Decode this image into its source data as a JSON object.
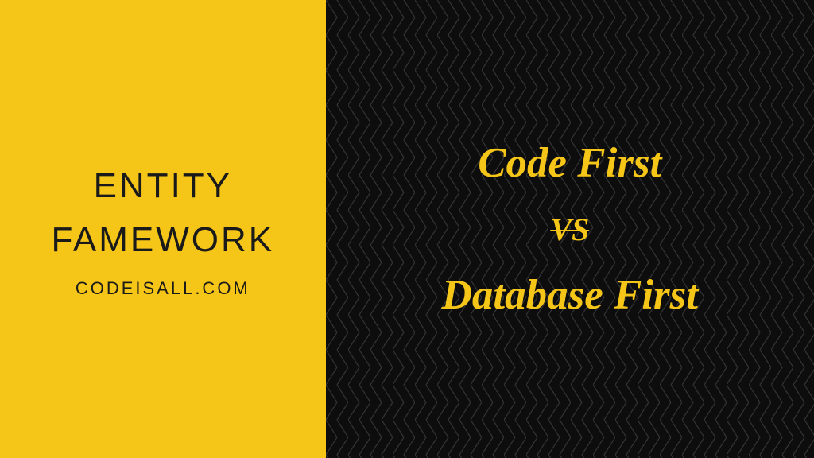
{
  "left": {
    "title": "ENTITY\nFAMEWORK",
    "subtitle": "CODEISALL.COM"
  },
  "right": {
    "line1": "Code First",
    "vs": "VS",
    "line2": "Database First"
  }
}
